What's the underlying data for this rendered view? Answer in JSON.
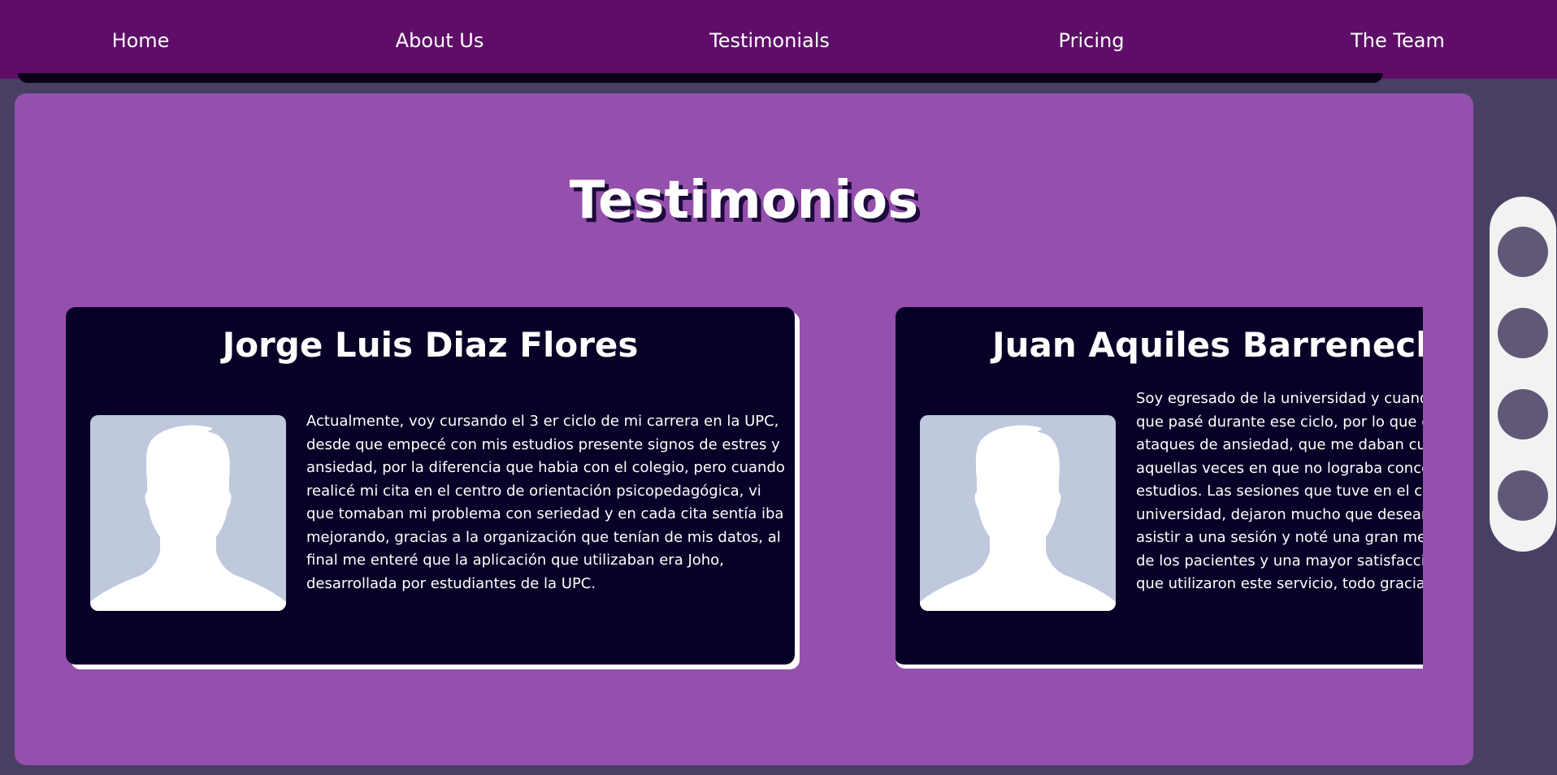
{
  "nav": {
    "items": [
      {
        "label": "Home"
      },
      {
        "label": "About Us"
      },
      {
        "label": "Testimonials"
      },
      {
        "label": "Pricing"
      },
      {
        "label": "The Team"
      }
    ]
  },
  "main": {
    "title": "Testimonios"
  },
  "testimonials": [
    {
      "name": "Jorge Luis Diaz Flores",
      "text": "Actualmente, voy cursando el 3 er ciclo de mi carrera en la UPC, desde que empecé con mis estudios presente signos de estres y ansiedad, por la diferencia que habia con el colegio, pero cuando realicé mi cita en el centro de orientación psicopedagógica, vi que tomaban mi problema con seriedad y en cada cita sentía iba mejorando, gracias a la organización que tenían de mis datos, al final me enteré que la aplicación que utilizaban era Joho, desarrollada por estudiantes de la UPC."
    },
    {
      "name": "Juan Aquiles Barrenecheα",
      "text": "Soy egresado de la universidad y cuando estudiaba recuerdo los problemas que pasé durante ese ciclo, por lo que decidí buscar una solución a mis ataques de ansiedad, que me daban cuando realizaba una exposición o aquellas veces en que no lograba concentrarme y enfocarme en mis estudios. Las sesiones que tuve en el centro de orientación de la universidad, dejaron mucho que desear. Después de unos ciclos volví a asistir a una sesión y noté una gran mejora en el manejo de la información de los pacientes y una mayor satisfacción que muchos de mis compañeros que utilizaron este servicio, todo gracias a la aplicación."
    }
  ],
  "carousel": {
    "dots": 4
  },
  "colors": {
    "nav_bg": "#5e0e68",
    "page_bg": "#483f63",
    "panel_bg": "#9450ac",
    "card_bg": "#080026",
    "avatar_bg": "#bfc8dd",
    "dot": "#615777",
    "scroller_bg": "#f2f2f2"
  },
  "icons": {
    "avatar": "person-silhouette-icon"
  }
}
